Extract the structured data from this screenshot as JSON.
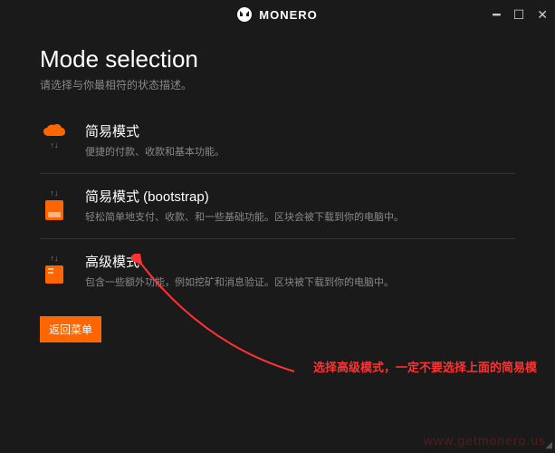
{
  "app": {
    "name": "MONERO"
  },
  "page": {
    "title": "Mode selection",
    "subtitle": "请选择与你最相符的状态描述。"
  },
  "modes": [
    {
      "title": "简易模式",
      "desc": "便捷的付款、收款和基本功能。"
    },
    {
      "title": "简易模式 (bootstrap)",
      "desc": "轻松简单地支付、收款、和一些基础功能。区块会被下载到你的电脑中。"
    },
    {
      "title": "高级模式",
      "desc": "包含一些额外功能，例如挖矿和消息验证。区块被下载到你的电脑中。"
    }
  ],
  "buttons": {
    "back": "返回菜单"
  },
  "annotation": {
    "text": "选择高级模式，一定不要选择上面的简易模"
  },
  "watermark": "www.getmonero.us"
}
